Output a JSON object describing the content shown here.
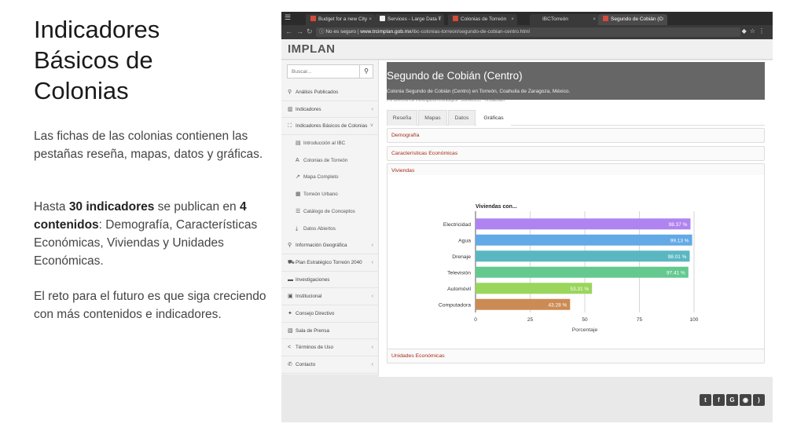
{
  "slide": {
    "title_lines": [
      "Indicadores",
      "Básicos de",
      "Colonias"
    ],
    "para1": "Las fichas de las colonias contienen las pestañas reseña, mapas, datos y gráficas.",
    "para2": {
      "t1": "Hasta ",
      "b1": "30 indicadores",
      "t2": " se publican en ",
      "b2": "4 contenidos",
      "t3": ": Demografía, Características Económicas, Viviendas y Unidades Económicas."
    },
    "para3": "El reto para el futuro es que siga creciendo con más contenidos e indicadores."
  },
  "browser": {
    "tabs": [
      {
        "label": "Budget for a new City",
        "fav": "#d64a3a"
      },
      {
        "label": "Services - Large Data T",
        "fav": "#f0f0f0"
      },
      {
        "label": "Colonias de Torreón",
        "fav": "#d64a3a"
      },
      {
        "label": "IBCTorreón",
        "fav": "#3a3a3a"
      },
      {
        "label": "Segundo de Cobián (C",
        "fav": "#d64a3a"
      }
    ],
    "url_warn": "No es seguro",
    "url_domain": "www.trcimplan.gob.mx",
    "url_path": "/ibc-colonias-torreon/segundo-de-cobian-centro.html"
  },
  "site": {
    "brand": "IMPLAN",
    "search_placeholder": "Buscar...",
    "sidebar": [
      {
        "label": "Análisis Publicados",
        "icon": "pin-icon",
        "glyph": "⚲",
        "sub": false,
        "arrow": ""
      },
      {
        "label": "Indicadores",
        "icon": "chart-icon",
        "glyph": "▥",
        "sub": false,
        "arrow": "‹"
      },
      {
        "label": "Indicadores Básicos de Colonias",
        "icon": "sitemap-icon",
        "glyph": "⛶",
        "sub": false,
        "arrow": "˅"
      },
      {
        "label": "Introducción al IBC",
        "icon": "doc-icon",
        "glyph": "▤",
        "sub": true,
        "arrow": ""
      },
      {
        "label": "Colonias de Torreón",
        "icon": "font-icon",
        "glyph": "A",
        "sub": true,
        "arrow": ""
      },
      {
        "label": "Mapa Completo",
        "icon": "external-icon",
        "glyph": "↗",
        "sub": true,
        "arrow": ""
      },
      {
        "label": "Torreón Urbano",
        "icon": "table-icon",
        "glyph": "▦",
        "sub": true,
        "arrow": ""
      },
      {
        "label": "Catálogo de Conceptos",
        "icon": "list-icon",
        "glyph": "☰",
        "sub": true,
        "arrow": ""
      },
      {
        "label": "Datos Abiertos",
        "icon": "download-icon",
        "glyph": "⤓",
        "sub": true,
        "arrow": ""
      },
      {
        "label": "Información Geográfica",
        "icon": "marker-icon",
        "glyph": "⚲",
        "sub": false,
        "arrow": "‹"
      },
      {
        "label": "Plan Estratégico Torreón 2040",
        "icon": "car-icon",
        "glyph": "⛟",
        "sub": false,
        "arrow": "‹"
      },
      {
        "label": "Investigaciones",
        "icon": "folder-icon",
        "glyph": "▬",
        "sub": false,
        "arrow": ""
      },
      {
        "label": "Institucional",
        "icon": "building-icon",
        "glyph": "▣",
        "sub": false,
        "arrow": "‹"
      },
      {
        "label": "Consejo Directivo",
        "icon": "users-icon",
        "glyph": "✦",
        "sub": false,
        "arrow": ""
      },
      {
        "label": "Sala de Prensa",
        "icon": "newspaper-icon",
        "glyph": "▧",
        "sub": false,
        "arrow": ""
      },
      {
        "label": "Términos de Uso",
        "icon": "share-icon",
        "glyph": "<",
        "sub": false,
        "arrow": "‹"
      },
      {
        "label": "Contacto",
        "icon": "phone-icon",
        "glyph": "✆",
        "sub": false,
        "arrow": "‹"
      }
    ],
    "page_title": "Segundo de Cobián (Centro)",
    "page_subtitle": "Colonia Segundo de Cobián (Centro) en Torreón, Coahuila de Zaragoza, México.",
    "meta": "Por Dirección de Investigación Estratégica · 25/ene/2017 · Actualizado",
    "tabs": [
      "Reseña",
      "Mapas",
      "Datos",
      "Gráficas"
    ],
    "active_tab": 3,
    "panels": {
      "demografia": "Demografía",
      "economicas": "Características Económicas",
      "viviendas": "Viviendas",
      "unidades": "Unidades Económicas"
    }
  },
  "chart_data": {
    "type": "bar",
    "orientation": "horizontal",
    "title": "Viviendas con...",
    "xlabel": "Porcentaje",
    "ylabel": "",
    "xlim": [
      0,
      100
    ],
    "xticks": [
      0,
      25,
      50,
      75,
      100
    ],
    "grid": true,
    "categories": [
      "Electricidad",
      "Agua",
      "Drenaje",
      "Televisión",
      "Automóvil",
      "Computadora"
    ],
    "values": [
      98.37,
      99.13,
      98.01,
      97.41,
      53.31,
      43.28
    ],
    "value_labels": [
      "98.37 %",
      "99.13 %",
      "98.01 %",
      "97.41 %",
      "53.31 %",
      "43.28 %"
    ],
    "colors": [
      "#b084f0",
      "#62a9e6",
      "#5ab7c2",
      "#63c98f",
      "#9ad55c",
      "#cc8b54"
    ]
  }
}
